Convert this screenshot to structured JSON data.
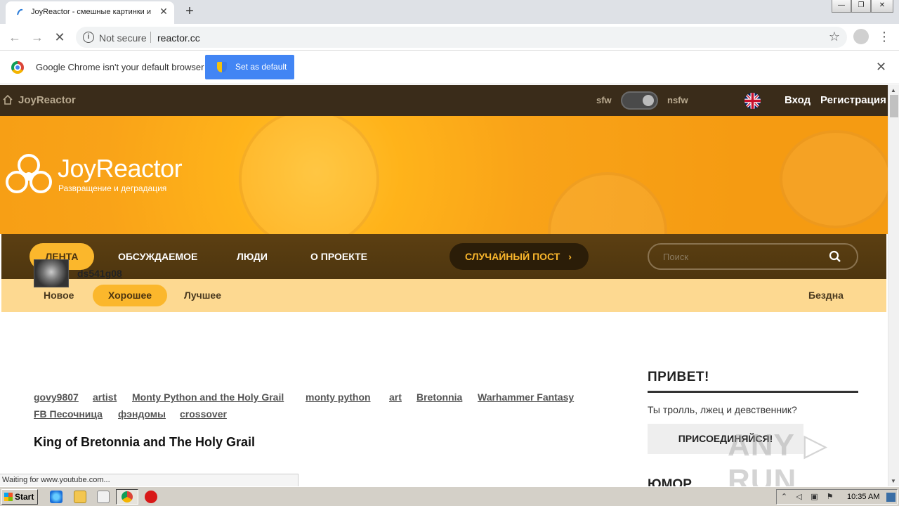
{
  "browser": {
    "tab_title": "JoyReactor - смешные картинки и",
    "tab_close": "✕",
    "new_tab": "+",
    "security_label": "Not secure",
    "url": "reactor.cc",
    "infobar_message": "Google Chrome isn't your default browser",
    "infobar_button": "Set as default",
    "infobar_close": "✕",
    "status_text": "Waiting for www.youtube.com..."
  },
  "site": {
    "topbar": {
      "brand": "JoyReactor",
      "sfw": "sfw",
      "nsfw": "nsfw",
      "login": "Вход",
      "register": "Регистрация"
    },
    "banner": {
      "logo_text": "JoyReactor",
      "slogan": "Развращение и деградация"
    },
    "main_nav": {
      "items": [
        "ЛЕНТА",
        "ОБСУЖДАЕМОЕ",
        "ЛЮДИ",
        "О ПРОЕКТЕ"
      ],
      "active": "ЛЕНТА",
      "random_post": "СЛУЧАЙНЫЙ ПОСТ",
      "random_chevron": "›",
      "search_placeholder": "Поиск"
    },
    "sub_nav": {
      "items": [
        "Новое",
        "Хорошее",
        "Лучшее"
      ],
      "active": "Хорошее",
      "abyss": "Бездна"
    },
    "post": {
      "author": "ds541g08",
      "tags_row1": [
        "govy9807",
        "artist",
        "Monty Python and the Holy Grail",
        "monty python",
        "art",
        "Bretonnia",
        "Warhammer Fantasy"
      ],
      "tags_row2": [
        "FB Песочница",
        "фэндомы",
        "crossover"
      ],
      "title": "King of Bretonnia and The Holy Grail"
    },
    "sidebar": {
      "hello": "ПРИВЕТ!",
      "greeting": "Ты тролль, лжец и девственник?",
      "join": "ПРИСОЕДИНЯЙСЯ!",
      "section": "ЮМОР"
    },
    "watermark": "ANY ▷ RUN"
  },
  "taskbar": {
    "start": "Start",
    "time": "10:35 AM"
  },
  "colors": {
    "accent": "#fbb72c",
    "topbar": "#3a2c1a",
    "nav": "#5c3f12",
    "subnav": "#fdd991",
    "chrome_button": "#4285f4"
  }
}
